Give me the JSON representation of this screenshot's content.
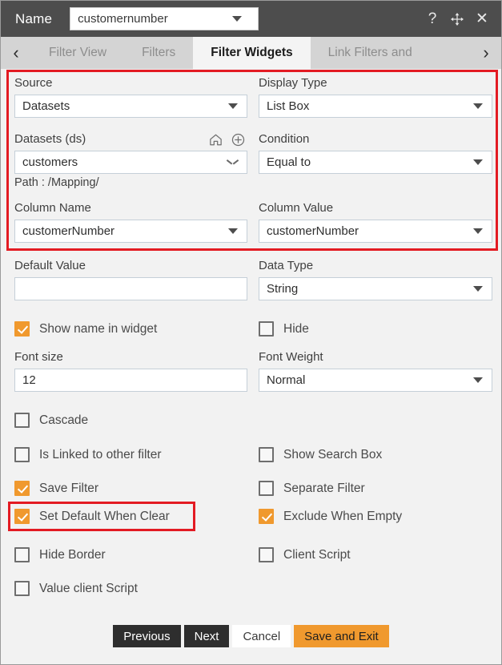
{
  "titlebar": {
    "name_label": "Name",
    "name_value": "customernumber",
    "help_icon": "question-mark-icon",
    "move_icon": "move-arrows-icon",
    "close_icon": "close-x-icon",
    "help_glyph": "?",
    "close_glyph": "✕"
  },
  "tabbar": {
    "prev_glyph": "‹",
    "next_glyph": "›",
    "tabs": [
      {
        "label": "Filter View",
        "active": false
      },
      {
        "label": "Filters",
        "active": false
      },
      {
        "label": "Filter Widgets",
        "active": true
      },
      {
        "label": "Link Filters and",
        "active": false
      }
    ]
  },
  "form": {
    "source": {
      "label": "Source",
      "value": "Datasets"
    },
    "display_type": {
      "label": "Display Type",
      "value": "List Box"
    },
    "datasets": {
      "label": "Datasets (ds)",
      "value": "customers",
      "path": "Path : /Mapping/"
    },
    "condition": {
      "label": "Condition",
      "value": "Equal to"
    },
    "column_name": {
      "label": "Column Name",
      "value": "customerNumber"
    },
    "column_value": {
      "label": "Column Value",
      "value": "customerNumber"
    },
    "default_value": {
      "label": "Default Value",
      "value": ""
    },
    "data_type": {
      "label": "Data Type",
      "value": "String"
    },
    "font_size": {
      "label": "Font size",
      "value": "12"
    },
    "font_weight": {
      "label": "Font Weight",
      "value": "Normal"
    }
  },
  "checkboxes": {
    "show_name_in_widget": {
      "label": "Show name in widget",
      "checked": true
    },
    "hide": {
      "label": "Hide",
      "checked": false
    },
    "cascade": {
      "label": "Cascade",
      "checked": false
    },
    "is_linked_to_other_filter": {
      "label": "Is Linked to other filter",
      "checked": false
    },
    "show_search_box": {
      "label": "Show Search Box",
      "checked": false
    },
    "save_filter": {
      "label": "Save Filter",
      "checked": true
    },
    "separate_filter": {
      "label": "Separate Filter",
      "checked": false
    },
    "set_default_when_clear": {
      "label": "Set Default When Clear",
      "checked": true
    },
    "exclude_when_empty": {
      "label": "Exclude When Empty",
      "checked": true
    },
    "hide_border": {
      "label": "Hide Border",
      "checked": false
    },
    "client_script": {
      "label": "Client Script",
      "checked": false
    },
    "value_client_script": {
      "label": "Value client Script",
      "checked": false
    }
  },
  "footer": {
    "previous": "Previous",
    "next": "Next",
    "cancel": "Cancel",
    "save_and_exit": "Save and Exit"
  },
  "colors": {
    "accent": "#f0992e",
    "highlight": "#e31b23",
    "titlebar": "#4d4d4d",
    "background": "#f2f2f2"
  }
}
